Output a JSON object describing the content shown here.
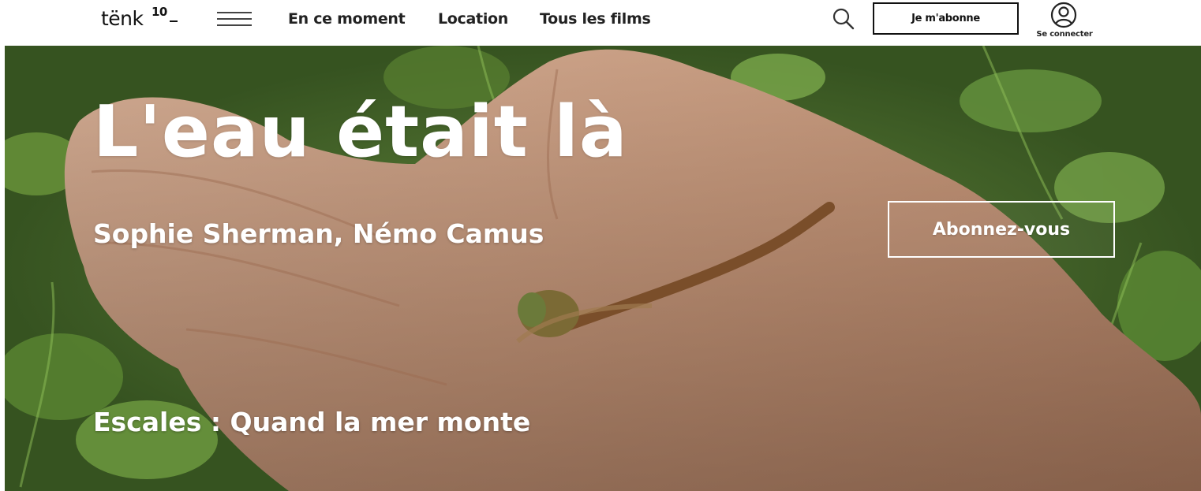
{
  "header": {
    "logo_text": "tënk",
    "logo_sup": "10",
    "menu_icon": "hamburger-menu-icon",
    "nav": [
      {
        "label": "En ce moment"
      },
      {
        "label": "Location"
      },
      {
        "label": "Tous les films"
      }
    ],
    "search_icon": "search-icon",
    "subscribe_label": "Je m'abonne",
    "account_icon": "user-circle-icon",
    "login_label": "Se connecter"
  },
  "hero": {
    "title": "L'eau était là",
    "directors": "Sophie Sherman, Némo Camus",
    "cta_label": "Abonnez-vous",
    "collection": "Escales : Quand la mer monte"
  },
  "colors": {
    "background": "#ffffff",
    "text": "#111111",
    "hero_text": "#ffffff",
    "foliage": "#4d6b2e",
    "skin": "#c99a7a"
  }
}
